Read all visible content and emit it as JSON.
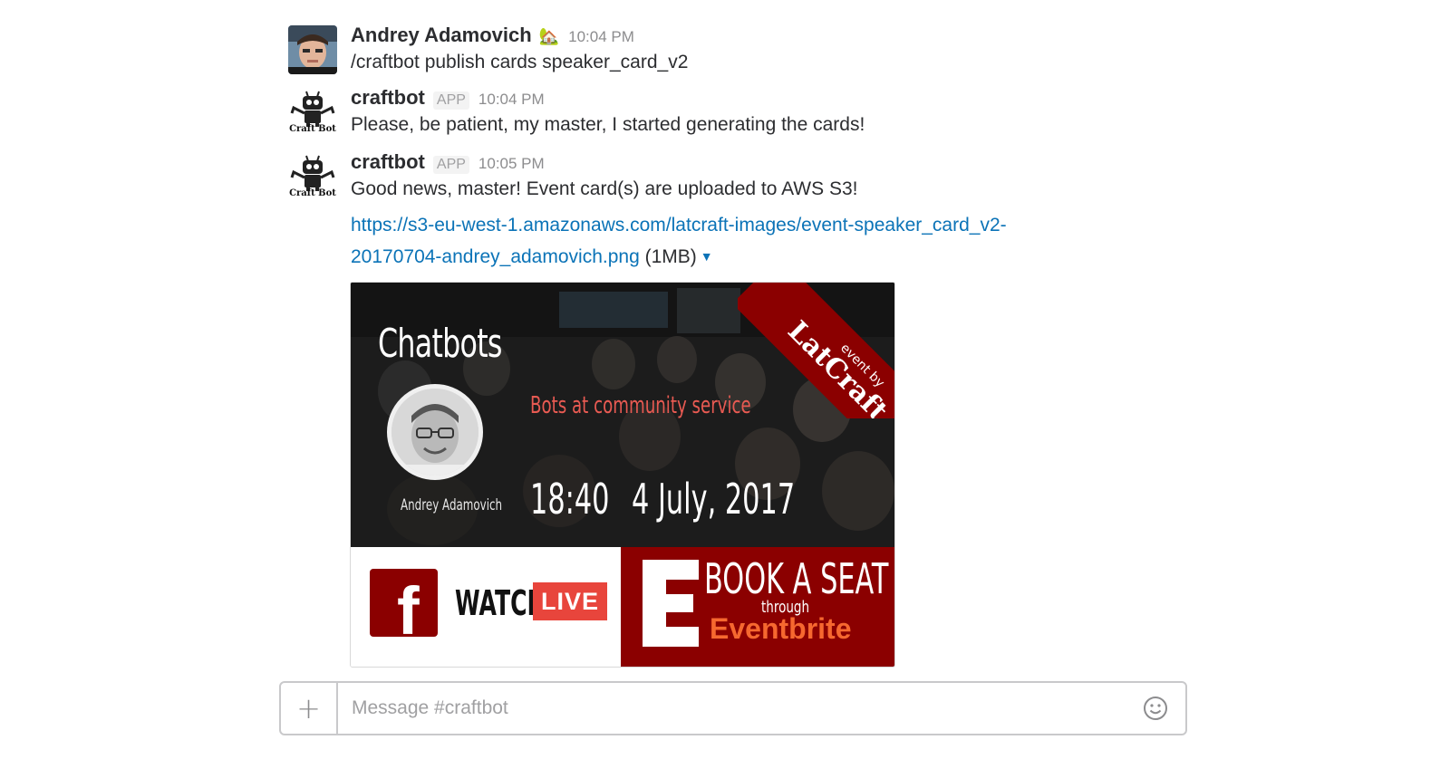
{
  "messages": [
    {
      "author": "Andrey Adamovich",
      "status_emoji": "🏡",
      "time": "10:04 PM",
      "text": "/craftbot publish cards speaker_card_v2"
    },
    {
      "author": "craftbot",
      "badge": "APP",
      "time": "10:04 PM",
      "text": "Please, be patient, my master, I started generating the cards!",
      "avatar_caption": "Craft Bot"
    },
    {
      "author": "craftbot",
      "badge": "APP",
      "time": "10:05 PM",
      "text": "Good news, master! Event card(s) are uploaded to AWS S3!",
      "avatar_caption": "Craft Bot",
      "link_line1": "https://s3-eu-west-1.amazonaws.com/latcraft-images/event-speaker_card_v2-",
      "link_line2": "20170704-andrey_adamovich.png",
      "file_size": "(1MB)"
    }
  ],
  "card": {
    "title": "Chatbots",
    "subtitle": "Bots at community service",
    "speaker": "Andrey Adamovich",
    "time": "18:40",
    "date": "4 July, 2017",
    "ribbon_small": "event by",
    "ribbon_big": "LatCraft",
    "watch": "WATCH",
    "live": "LIVE",
    "book": "BOOK A SEAT",
    "through": "through",
    "eventbrite": "Eventbrite"
  },
  "composer": {
    "placeholder": "Message #craftbot",
    "add_icon": "plus-icon",
    "emoji_icon": "smiley-icon"
  },
  "colors": {
    "link": "#0b73b7",
    "ribbon": "#8b0000",
    "live": "#e8453c",
    "eventbrite": "#f6682f"
  }
}
